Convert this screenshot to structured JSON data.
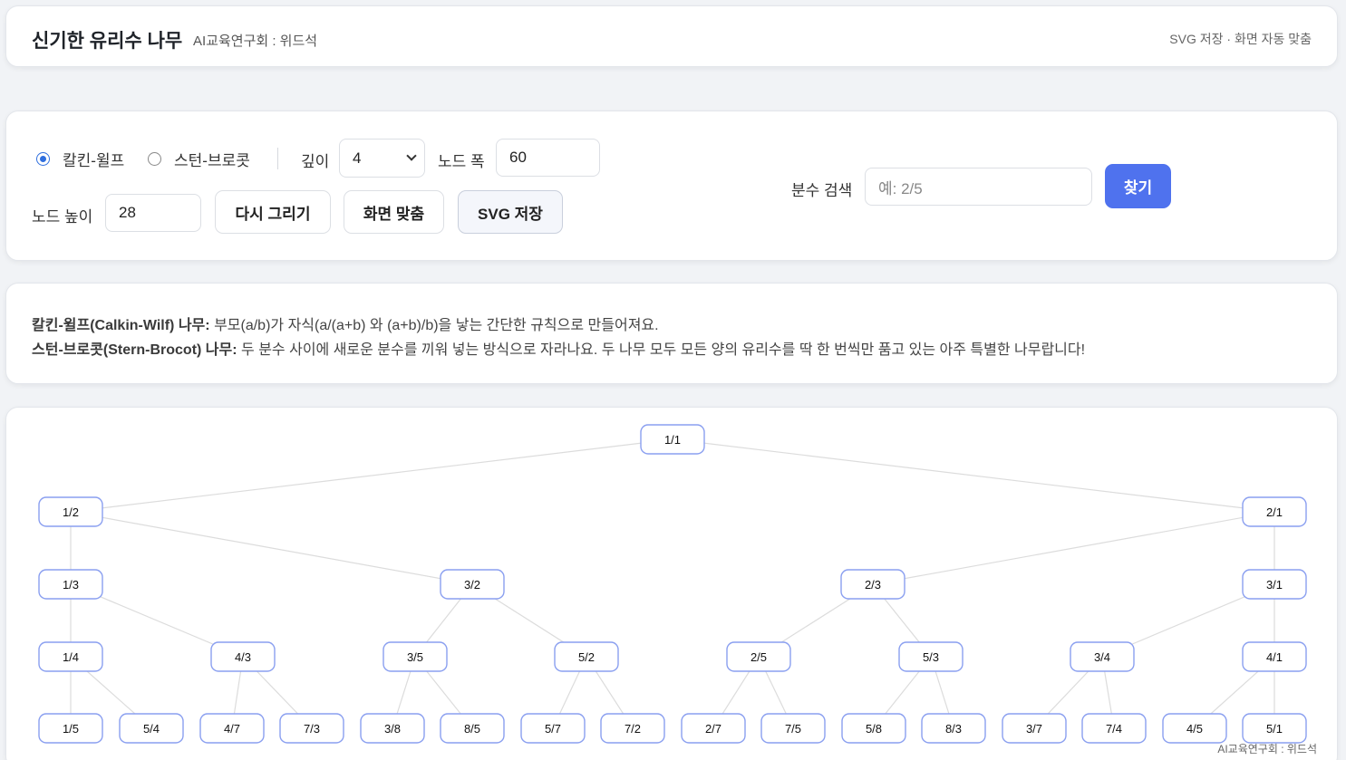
{
  "header": {
    "title": "신기한 유리수 나무",
    "author": "AI교육연구회 : 위드석",
    "hint": "SVG 저장 · 화면 자동 맞춤"
  },
  "controls": {
    "mode_calkin": "칼킨-윌프",
    "mode_stern": "스턴-브로콧",
    "selected_mode": "칼킨-윌프",
    "depth_label": "깊이",
    "depth_value": "4",
    "node_width_label": "노드 폭",
    "node_width_value": "60",
    "node_height_label": "노드 높이",
    "node_height_value": "28",
    "redraw_label": "다시 그리기",
    "fit_label": "화면 맞춤",
    "save_svg_label": "SVG 저장",
    "search_label": "분수 검색",
    "search_placeholder": "예: 2/5",
    "find_label": "찾기"
  },
  "info": {
    "calkin_title": "칼킨-윌프(Calkin-Wilf) 나무:",
    "calkin_text": "부모(a/b)가 자식(a/(a+b) 와 (a+b)/b)을 낳는 간단한 규칙으로 만들어져요.",
    "stern_title": "스턴-브로콧(Stern-Brocot) 나무:",
    "stern_text": "두 분수 사이에 새로운 분수를 끼워 넣는 방식으로 자라나요. 두 나무 모두 모든 양의 유리수를 딱 한 번씩만 품고 있는 아주 특별한 나무랍니다!"
  },
  "tree": {
    "levels": [
      [
        "1/1"
      ],
      [
        "1/2",
        "2/1"
      ],
      [
        "1/3",
        "3/2",
        "2/3",
        "3/1"
      ],
      [
        "1/4",
        "4/3",
        "3/5",
        "5/2",
        "2/5",
        "5/3",
        "3/4",
        "4/1"
      ],
      [
        "1/5",
        "5/4",
        "4/7",
        "7/3",
        "3/8",
        "8/5",
        "5/7",
        "7/2",
        "2/7",
        "7/5",
        "5/8",
        "8/3",
        "3/7",
        "7/4",
        "4/5",
        "5/1"
      ]
    ]
  },
  "footer": {
    "credit": "AI교육연구회 : 위드석"
  },
  "colors": {
    "accent": "#4f72ee",
    "node_border": "#8a9ff0",
    "edge": "#dcdcdc"
  }
}
